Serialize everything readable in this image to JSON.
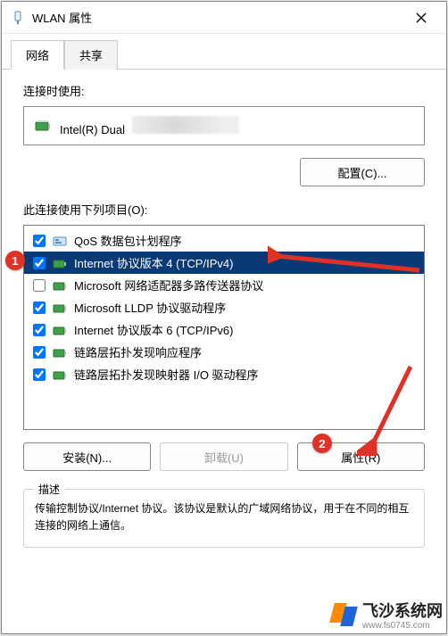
{
  "window_title": "WLAN 属性",
  "tabs": {
    "network": "网络",
    "sharing": "共享"
  },
  "connect_using_label": "连接时使用:",
  "adapter_name": "Intel(R) Dual",
  "configure_button": "配置(C)...",
  "items_label": "此连接使用下列项目(O):",
  "items": [
    {
      "label": "QoS 数据包计划程序",
      "checked": true,
      "selected": false,
      "icon": "qos"
    },
    {
      "label": "Internet 协议版本 4 (TCP/IPv4)",
      "checked": true,
      "selected": true,
      "icon": "proto"
    },
    {
      "label": "Microsoft 网络适配器多路传送器协议",
      "checked": false,
      "selected": false,
      "icon": "proto"
    },
    {
      "label": "Microsoft LLDP 协议驱动程序",
      "checked": true,
      "selected": false,
      "icon": "proto"
    },
    {
      "label": "Internet 协议版本 6 (TCP/IPv6)",
      "checked": true,
      "selected": false,
      "icon": "proto"
    },
    {
      "label": "链路层拓扑发现响应程序",
      "checked": true,
      "selected": false,
      "icon": "proto"
    },
    {
      "label": "链路层拓扑发现映射器 I/O 驱动程序",
      "checked": true,
      "selected": false,
      "icon": "proto"
    }
  ],
  "buttons": {
    "install": "安装(N)...",
    "uninstall": "卸载(U)",
    "properties": "属性(R)"
  },
  "description_header": "描述",
  "description_text": "传输控制协议/Internet 协议。该协议是默认的广域网络协议，用于在不同的相互连接的网络上通信。",
  "annotations": {
    "badge1": "1",
    "badge2": "2"
  },
  "watermark": {
    "name": "飞沙系统网",
    "url": "www.fs0745.com"
  }
}
